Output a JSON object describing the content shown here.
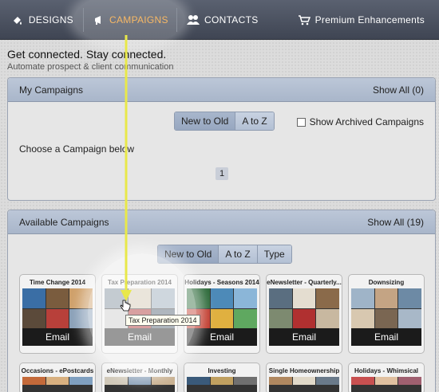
{
  "nav": {
    "designs": "DESIGNS",
    "campaigns": "CAMPAIGNS",
    "contacts": "CONTACTS",
    "premium": "Premium Enhancements",
    "active_color": "#f5a43a"
  },
  "hero": {
    "tagline": "Get connected. Stay connected.",
    "subtagline": "Automate prospect & client communication"
  },
  "my_campaigns": {
    "title": "My Campaigns",
    "show_all": "Show All (0)",
    "sort": [
      "New to Old",
      "A to Z"
    ],
    "archived_label": "Show Archived Campaigns",
    "empty_text": "Choose a Campaign below",
    "page": "1"
  },
  "available": {
    "title": "Available Campaigns",
    "show_all": "Show All (19)",
    "sort": [
      "New to Old",
      "A to Z",
      "Type"
    ],
    "cards": [
      {
        "title": "Time Change 2014",
        "button": "Email"
      },
      {
        "title": "Tax Preparation 2014",
        "button": "Email"
      },
      {
        "title": "Holidays - Seasons 2014",
        "button": "Email"
      },
      {
        "title": "eNewsletter - Quarterly...",
        "button": "Email"
      },
      {
        "title": "Downsizing",
        "button": "Email"
      },
      {
        "title": "Occasions - ePostcards"
      },
      {
        "title": "eNewsletter - Monthly"
      },
      {
        "title": "Investing"
      },
      {
        "title": "Single Homeownership"
      },
      {
        "title": "Holidays - Whimsical"
      }
    ]
  },
  "tooltip": "Tax Preparation 2014"
}
